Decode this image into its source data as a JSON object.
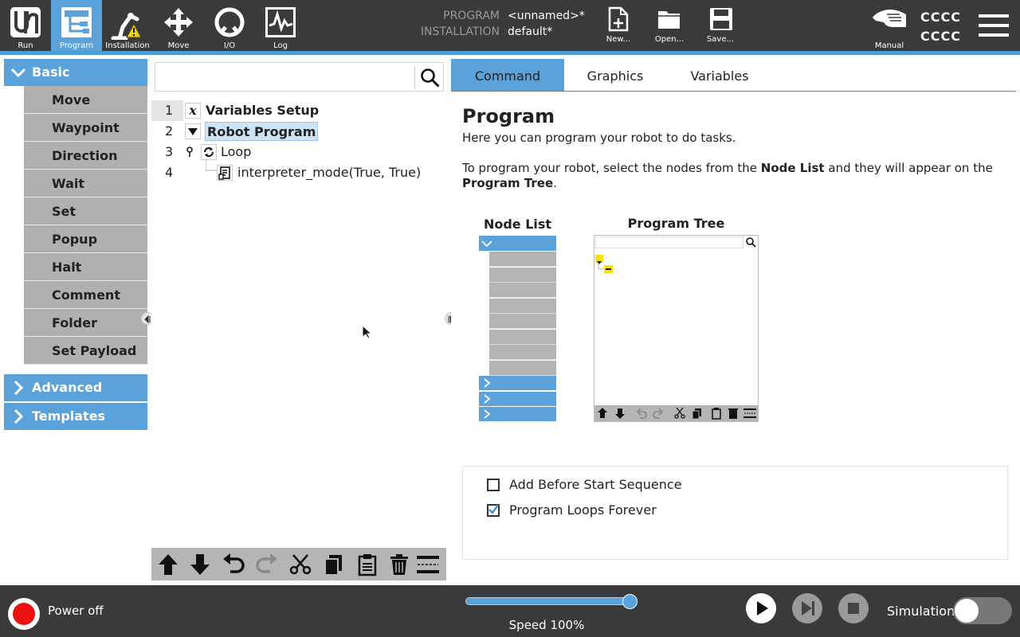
{
  "topbar": {
    "nav": [
      {
        "label": "Run",
        "icon": "ur-logo-icon"
      },
      {
        "label": "Program",
        "icon": "program-tree-icon",
        "active": true
      },
      {
        "label": "Installation",
        "icon": "robot-arm-warning-icon"
      },
      {
        "label": "Move",
        "icon": "move-arrows-icon"
      },
      {
        "label": "I/O",
        "icon": "io-icon"
      },
      {
        "label": "Log",
        "icon": "log-waveform-icon"
      }
    ],
    "program_key": "PROGRAM",
    "program_value": "<unnamed>*",
    "installation_key": "INSTALLATION",
    "installation_value": "default*",
    "file": [
      {
        "label": "New...",
        "icon": "new-file-icon"
      },
      {
        "label": "Open...",
        "icon": "open-folder-icon"
      },
      {
        "label": "Save...",
        "icon": "save-disk-icon"
      }
    ],
    "mode_label": "Manual",
    "user_line1": "CCCC",
    "user_line2": "CCCC"
  },
  "sidebar": {
    "basic_label": "Basic",
    "basic_items": [
      "Move",
      "Waypoint",
      "Direction",
      "Wait",
      "Set",
      "Popup",
      "Halt",
      "Comment",
      "Folder",
      "Set Payload"
    ],
    "advanced_label": "Advanced",
    "templates_label": "Templates"
  },
  "tree": {
    "search_placeholder": "",
    "rows": [
      {
        "num": "1",
        "label": "Variables Setup"
      },
      {
        "num": "2",
        "label": "Robot Program"
      },
      {
        "num": "3",
        "label": "Loop"
      },
      {
        "num": "4",
        "label": "interpreter_mode(True, True)"
      }
    ]
  },
  "right": {
    "tabs": [
      "Command",
      "Graphics",
      "Variables"
    ],
    "heading": "Program",
    "intro": "Here you can program your robot to do tasks.",
    "instr_pre": "To program your robot, select the nodes from the",
    "instr_b1": "Node List",
    "instr_mid": "and they will appear on the",
    "instr_b2": "Program Tree",
    "instr_end": ".",
    "node_list_title": "Node List",
    "program_tree_title": "Program Tree",
    "options": [
      {
        "label": "Add Before Start Sequence",
        "checked": false
      },
      {
        "label": "Program Loops Forever",
        "checked": true
      }
    ]
  },
  "footer": {
    "power_label": "Power off",
    "speed_label": "Speed 100%",
    "speed_fraction": 1.0,
    "simulation_label": "Simulation",
    "simulation_on": false
  },
  "colors": {
    "accent": "#5aa2d9",
    "topbar": "#3a3a3a",
    "power": "#e11111"
  }
}
